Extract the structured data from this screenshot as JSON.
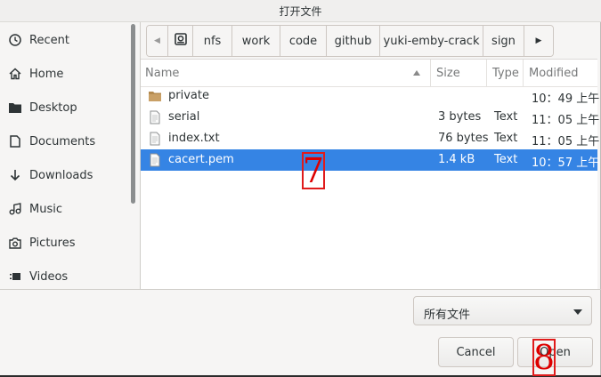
{
  "window": {
    "title": "打开文件"
  },
  "sidebar": {
    "items": [
      {
        "label": "Recent",
        "icon": "clock-icon"
      },
      {
        "label": "Home",
        "icon": "home-icon"
      },
      {
        "label": "Desktop",
        "icon": "folder-icon"
      },
      {
        "label": "Documents",
        "icon": "document-icon"
      },
      {
        "label": "Downloads",
        "icon": "download-arrow-icon"
      },
      {
        "label": "Music",
        "icon": "music-icon"
      },
      {
        "label": "Pictures",
        "icon": "camera-icon"
      },
      {
        "label": "Videos",
        "icon": "video-icon"
      }
    ]
  },
  "pathbar": {
    "left_arrow": "◀",
    "right_arrow": "▶",
    "drive_icon": "drive-icon",
    "crumbs": [
      "nfs",
      "work",
      "code",
      "github",
      "yuki-emby-crack",
      "sign"
    ]
  },
  "filelist": {
    "columns": {
      "name": "Name",
      "size": "Size",
      "type": "Type",
      "modified": "Modified"
    },
    "rows": [
      {
        "name": "private",
        "size": "",
        "type": "",
        "modified": "10：49 上午",
        "icon": "folder-icon",
        "selected": false
      },
      {
        "name": "serial",
        "size": "3 bytes",
        "type": "Text",
        "modified": "11：05 上午",
        "icon": "text-file-icon",
        "selected": false
      },
      {
        "name": "index.txt",
        "size": "76 bytes",
        "type": "Text",
        "modified": "11：05 上午",
        "icon": "text-file-icon",
        "selected": false
      },
      {
        "name": "cacert.pem",
        "size": "1.4 kB",
        "type": "Text",
        "modified": "10：57 上午",
        "icon": "text-file-icon",
        "selected": true
      }
    ]
  },
  "filter": {
    "selected": "所有文件"
  },
  "buttons": {
    "cancel": "Cancel",
    "open": "Open"
  },
  "annotations": {
    "seven": "7",
    "eight": "8"
  },
  "colors": {
    "selection": "#3584e4",
    "annotation": "#e01b1b"
  }
}
